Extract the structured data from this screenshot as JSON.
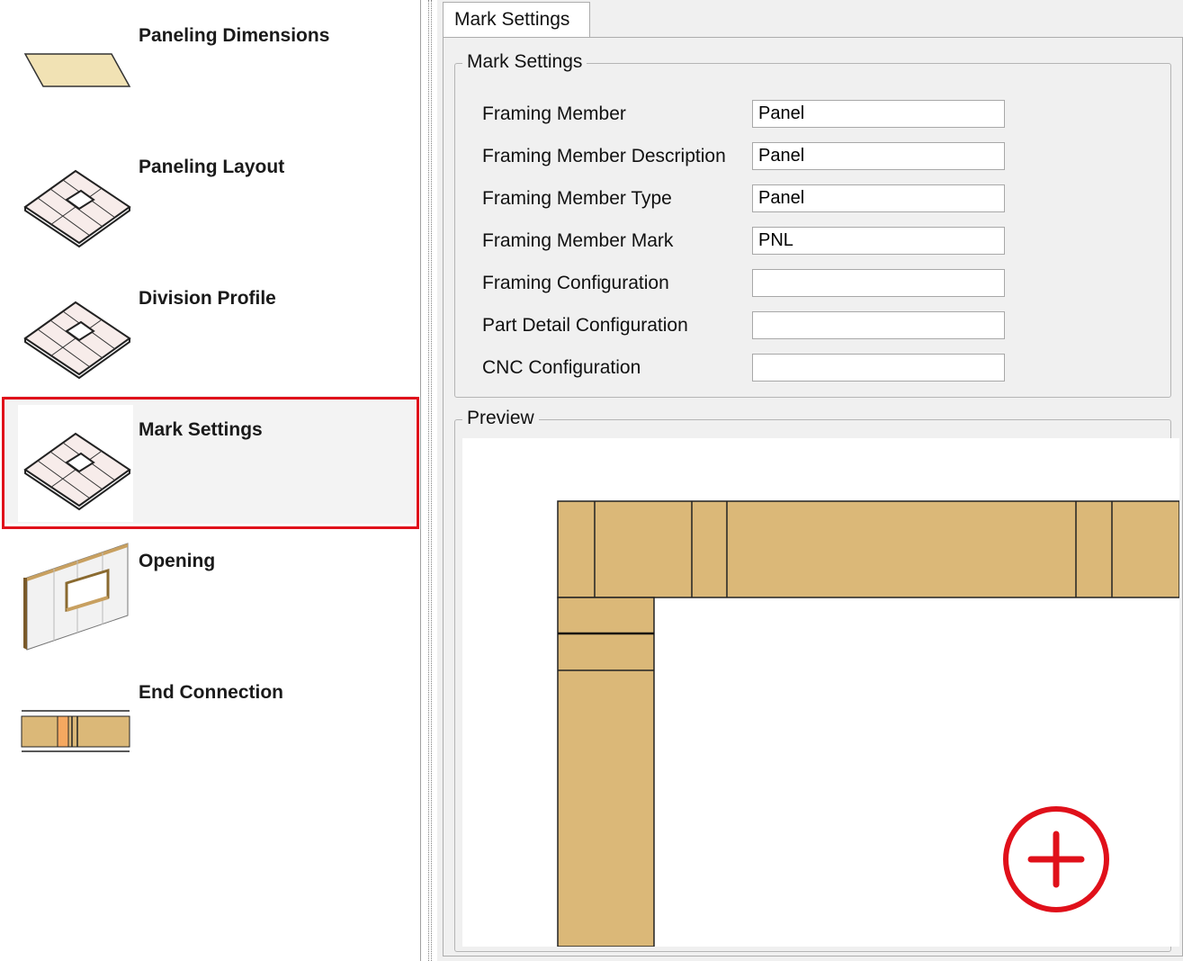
{
  "nav": {
    "items": [
      {
        "label": "Paneling Dimensions"
      },
      {
        "label": "Paneling Layout"
      },
      {
        "label": "Division Profile"
      },
      {
        "label": "Mark Settings",
        "selected": true
      },
      {
        "label": "Opening"
      },
      {
        "label": "End Connection"
      }
    ]
  },
  "tab": {
    "label": "Mark Settings"
  },
  "mark_settings": {
    "group_title": "Mark Settings",
    "fields": [
      {
        "label": "Framing Member",
        "value": "Panel"
      },
      {
        "label": "Framing Member Description",
        "value": "Panel"
      },
      {
        "label": "Framing Member Type",
        "value": "Panel"
      },
      {
        "label": "Framing Member Mark",
        "value": "PNL"
      },
      {
        "label": "Framing Configuration",
        "value": ""
      },
      {
        "label": "Part Detail Configuration",
        "value": ""
      },
      {
        "label": "CNC Configuration",
        "value": ""
      }
    ]
  },
  "preview": {
    "group_title": "Preview"
  },
  "colors": {
    "accent_highlight": "#e0101a",
    "wood": "#dbb878",
    "panel_face": "#f5e6c4"
  }
}
